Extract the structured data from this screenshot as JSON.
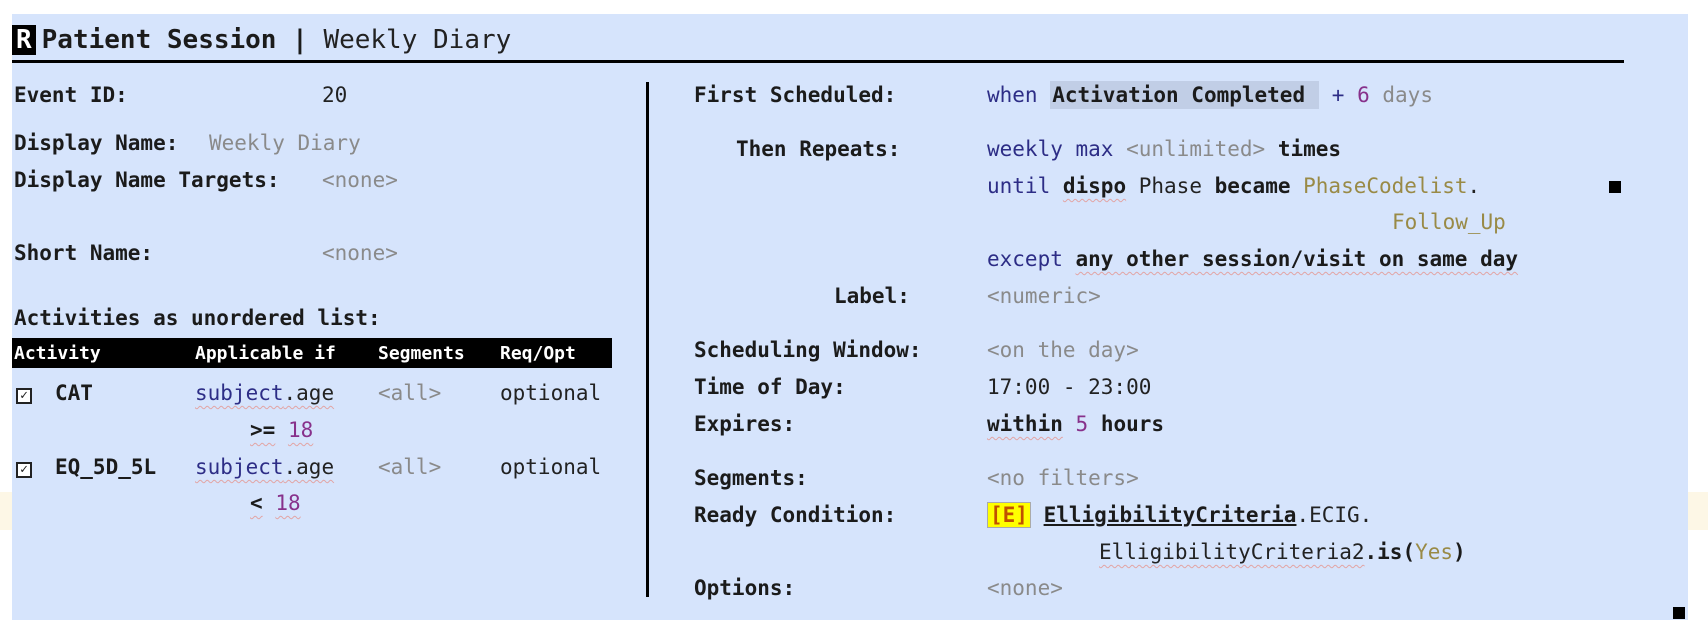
{
  "header": {
    "r_badge": "R",
    "title": "Patient Session",
    "separator": "|",
    "subtitle": "Weekly Diary"
  },
  "left": {
    "event_id_label": "Event ID:",
    "event_id_value": "20",
    "display_name_label": "Display Name:",
    "display_name_value": "Weekly Diary",
    "display_name_targets_label": "Display Name Targets:",
    "display_name_targets_value": "<none>",
    "short_name_label": "Short Name:",
    "short_name_value": "<none>",
    "activities_label": "Activities as unordered list:",
    "table": {
      "columns": [
        "Activity",
        "Applicable if",
        "Segments",
        "Req/Opt"
      ],
      "rows": [
        {
          "check": "✓",
          "activity": "CAT",
          "cond_obj": "subject",
          "cond_prop": ".age",
          "cond_op": ">=",
          "cond_num": "18",
          "segments": "<all>",
          "req": "optional"
        },
        {
          "check": "✓",
          "activity": "EQ_5D_5L",
          "cond_obj": "subject",
          "cond_prop": ".age",
          "cond_op": "<",
          "cond_num": "18",
          "segments": "<all>",
          "req": "optional"
        }
      ]
    }
  },
  "right": {
    "first_scheduled_label": "First Scheduled:",
    "fs_when": "when",
    "fs_event": "Activation Completed",
    "fs_plus": "+",
    "fs_num": "6",
    "fs_unit": "days",
    "then_repeats_label": "Then Repeats:",
    "tr_weekly": "weekly",
    "tr_max": "max",
    "tr_unlimited": "<unlimited>",
    "tr_times": "times",
    "tr_until": "until",
    "tr_dispo": "dispo",
    "tr_phase": "Phase",
    "tr_became": "became",
    "tr_codelist": "PhaseCodelist",
    "tr_dot": ".",
    "tr_followup": "Follow_Up",
    "tr_except": "except",
    "tr_except_text": "any other session/visit on same day",
    "label_label": "Label:",
    "label_value": "<numeric>",
    "window_label": "Scheduling Window:",
    "window_value": "<on the day>",
    "time_label": "Time of Day:",
    "time_value": "17:00 - 23:00",
    "expires_label": "Expires:",
    "exp_within": "within",
    "exp_num": "5",
    "exp_hours": "hours",
    "segments_label": "Segments:",
    "segments_value": "<no filters>",
    "ready_label": "Ready Condition:",
    "ready_badge": "[E]",
    "ready_crit": "ElligibilityCriteria",
    "ready_ecig": ".ECIG.",
    "ready_crit2": "ElligibilityCriteria2",
    "ready_is": ".is(",
    "ready_yes": "Yes",
    "ready_close": ")",
    "options_label": "Options:",
    "options_value": "<none>"
  },
  "colors": {
    "panel": "#d6e4fc",
    "keyword": "#2d2d86",
    "string": "#998a46",
    "number": "#87318b",
    "badge": "#ffff00"
  }
}
